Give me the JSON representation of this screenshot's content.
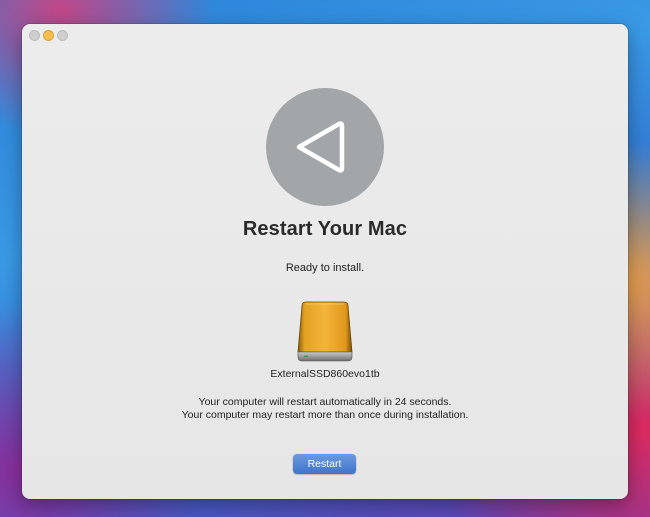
{
  "window": {
    "buttons": {
      "close": "close",
      "minimize": "minimize",
      "zoom": "zoom"
    }
  },
  "installer": {
    "icon": "restart-arrow-icon",
    "title": "Restart Your Mac",
    "status": "Ready to install.",
    "drive": {
      "icon": "external-drive-icon",
      "name": "ExternalSSD860evo1tb"
    },
    "message_line1": "Your computer will restart automatically in 24 seconds.",
    "message_line2": "Your computer may restart more than once during installation.",
    "restart_label": "Restart"
  },
  "colors": {
    "accent": "#3f74cc",
    "drive_orange": "#e0981c",
    "badge_gray": "#a3a6a8"
  }
}
